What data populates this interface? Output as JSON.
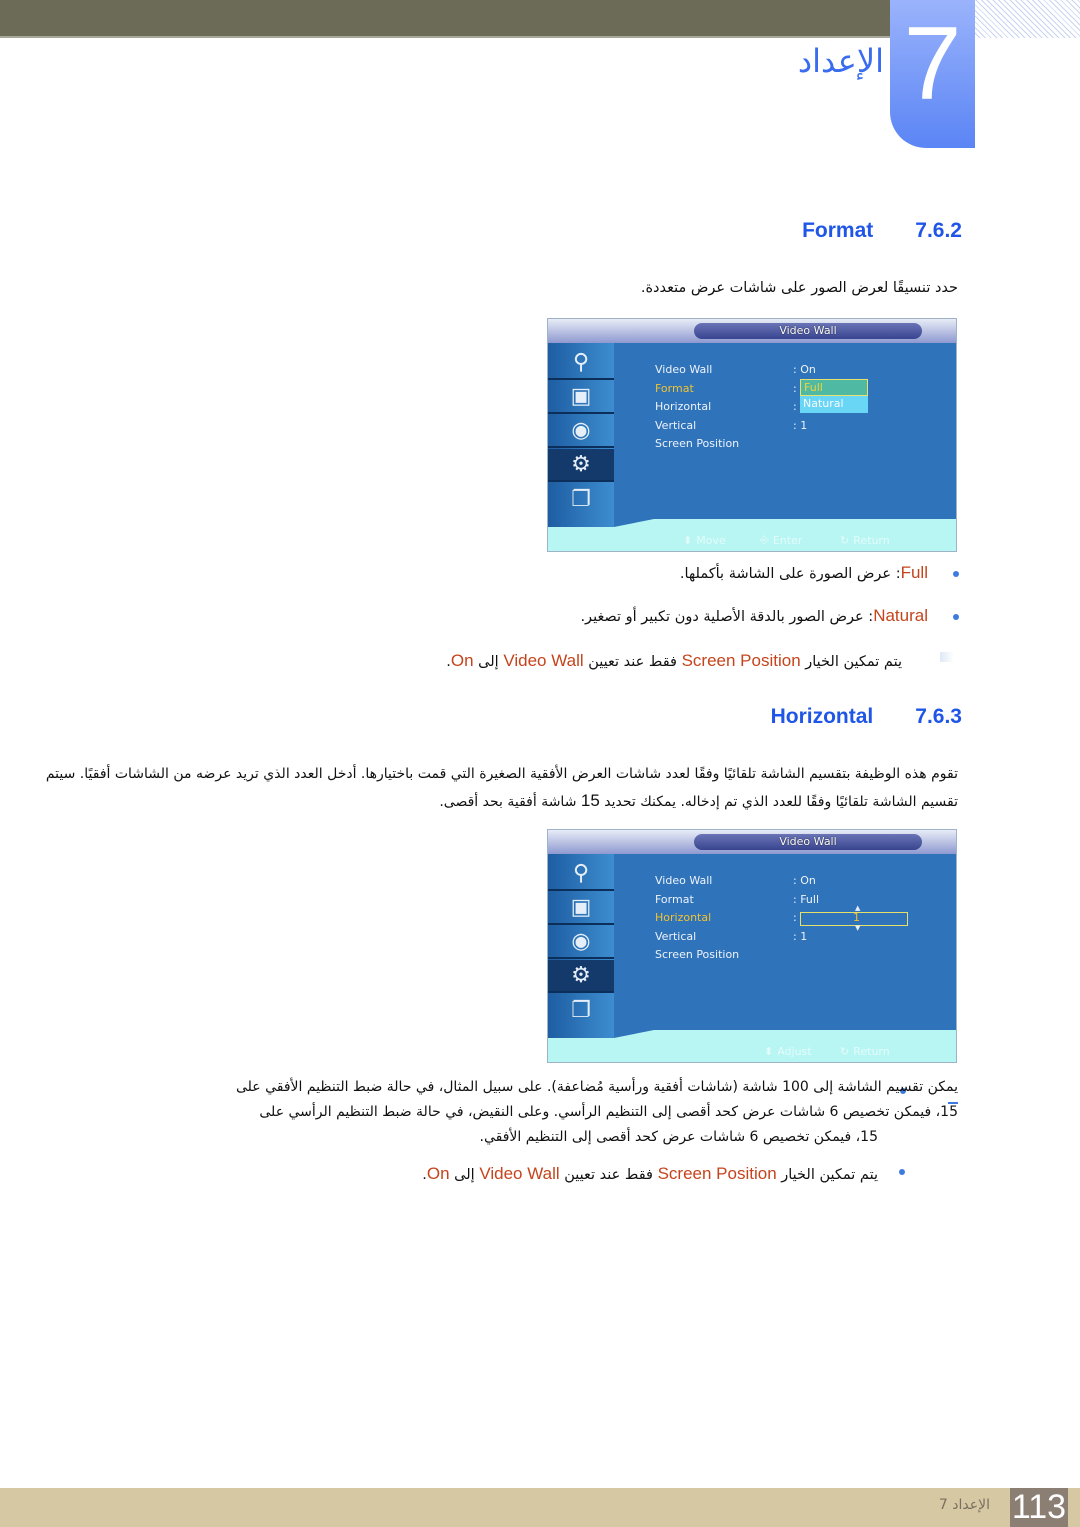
{
  "chapter": {
    "number": "7",
    "title": "الإعداد"
  },
  "sections": [
    {
      "number": "7.6.2",
      "name": "Format",
      "intro": "حدد تنسيقًا لعرض الصور على شاشات عرض متعددة.",
      "osd": {
        "title": "Video Wall",
        "rows": [
          {
            "label": "Video Wall",
            "value": ": On"
          },
          {
            "label": "Format",
            "value": ":"
          },
          {
            "label": "Horizontal",
            "value": ":"
          },
          {
            "label": "Vertical",
            "value": ": 1"
          },
          {
            "label": "Screen Position",
            "value": ""
          }
        ],
        "highlighted_row": "Format",
        "dropdown": [
          "Full",
          "Natural"
        ],
        "dropdown_selected": "Full",
        "footer": [
          {
            "icon": "updown-arrow-icon",
            "label": "Move"
          },
          {
            "icon": "enter-icon",
            "label": "Enter"
          },
          {
            "icon": "return-icon",
            "label": "Return"
          }
        ]
      },
      "bullets": [
        {
          "term": "Full",
          "text": ": عرض الصورة على الشاشة بأكملها."
        },
        {
          "term": "Natural",
          "text": ": عرض الصور بالدقة الأصلية دون تكبير أو تصغير."
        }
      ],
      "note": {
        "prefix": "يتم تمكين الخيار",
        "opt": "Screen Position",
        "mid": "فقط عند تعيين",
        "target": "Video Wall",
        "to": "إلى",
        "value": "On",
        "end": "."
      }
    },
    {
      "number": "7.6.3",
      "name": "Horizontal",
      "intro_line1": "تقوم هذه الوظيفة بتقسيم الشاشة تلقائيًا وفقًا لعدد شاشات العرض الأفقية الصغيرة التي قمت باختيارها. أدخل العدد الذي تريد عرضه من الشاشات أفقيًا. سيتم",
      "intro_line2_a": "تقسيم الشاشة تلقائيًا وفقًا للعدد الذي تم إدخاله. يمكنك تحديد",
      "intro_line2_num": "15",
      "intro_line2_b": "شاشة أفقية بحد أقصى.",
      "osd": {
        "title": "Video Wall",
        "rows": [
          {
            "label": "Video Wall",
            "value": ": On"
          },
          {
            "label": "Format",
            "value": ": Full"
          },
          {
            "label": "Horizontal",
            "value": ":"
          },
          {
            "label": "Vertical",
            "value": ": 1"
          },
          {
            "label": "Screen Position",
            "value": ""
          }
        ],
        "highlighted_row": "Horizontal",
        "stepper_value": "1",
        "footer": [
          {
            "icon": "updown-arrow-icon",
            "label": "Adjust"
          },
          {
            "icon": "return-icon",
            "label": "Return"
          }
        ]
      },
      "bullet1_line1": "يمكن تقسيم الشاشة إلى 100 شاشة (شاشات أفقية ورأسية مُضاعفة). على سبيل المثال، في حالة ضبط التنظيم الأفقي على",
      "bullet1_line2": "15، فيمكن تخصيص 6 شاشات عرض كحد أقصى إلى التنظيم الرأسي. وعلى النقيض، في حالة ضبط التنظيم الرأسي على",
      "bullet1_line3": "15، فيمكن تخصيص 6 شاشات عرض كحد أقصى إلى التنظيم الأفقي.",
      "note": {
        "prefix": "يتم تمكين الخيار",
        "opt": "Screen Position",
        "mid": "فقط عند تعيين",
        "target": "Video Wall",
        "to": "إلى",
        "value": "On",
        "end": "."
      }
    }
  ],
  "side_icons": [
    "input-plug-icon",
    "picture-icon",
    "sound-icon",
    "setup-gear-icon",
    "multi-control-icon"
  ],
  "footer": {
    "page_number": "113",
    "chapter_label": "الإعداد 7"
  }
}
